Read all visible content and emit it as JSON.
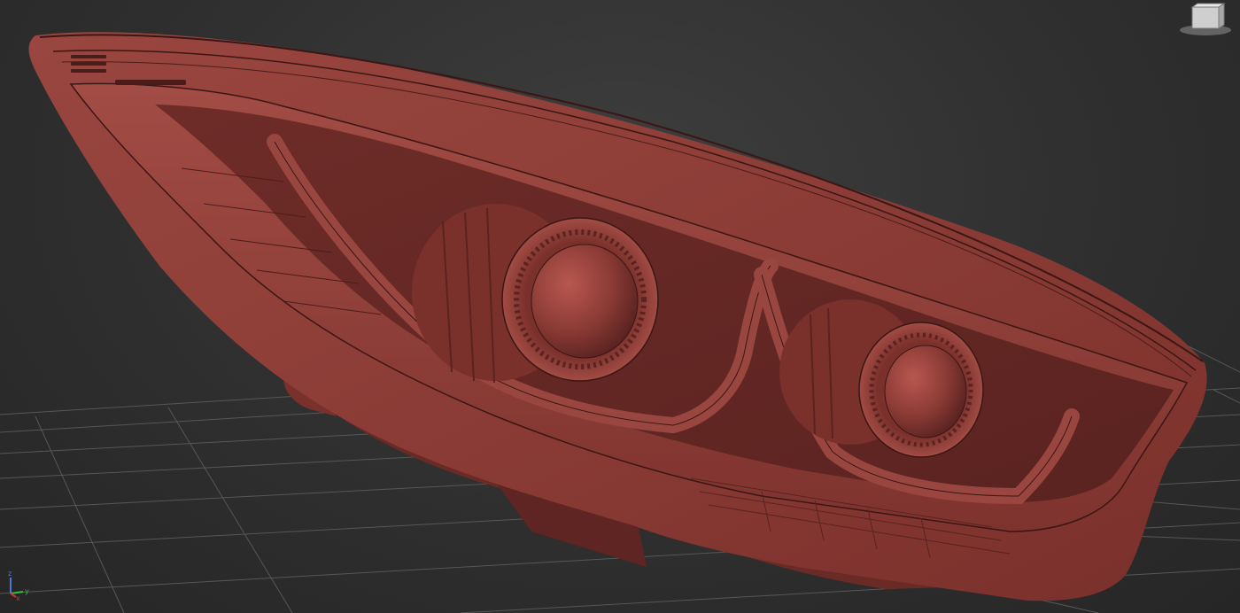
{
  "viewport": {
    "background": "#2f2f2f",
    "grid_color": "#575757",
    "model_color": "#8a3a35"
  },
  "model": {
    "name": "",
    "emblem_text": "",
    "lens_count": 2
  },
  "viewcube": {
    "face_label": "",
    "icon": "viewcube-icon"
  },
  "axis_tripod": {
    "x_label": "x",
    "y_label": "y",
    "z_label": "z",
    "x_color": "#d03030",
    "y_color": "#30c040",
    "z_color": "#4a7bd8"
  }
}
